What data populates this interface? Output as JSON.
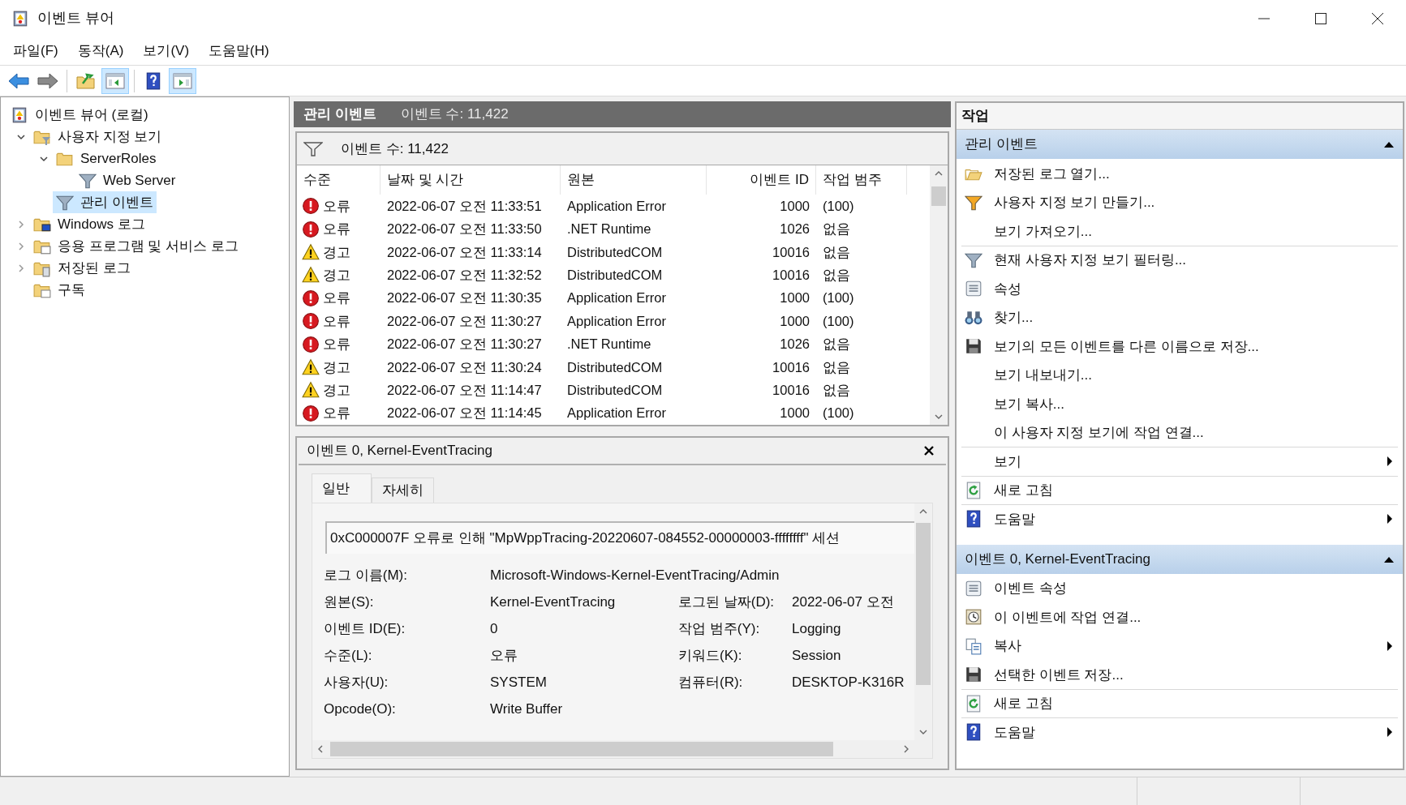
{
  "window": {
    "title": "이벤트 뷰어"
  },
  "menu": [
    "파일(F)",
    "동작(A)",
    "보기(V)",
    "도움말(H)"
  ],
  "toolbar": [
    {
      "kind": "back",
      "pressed": false
    },
    {
      "kind": "forward",
      "pressed": false
    },
    {
      "kind": "up",
      "pressed": false
    },
    {
      "kind": "tree-pane",
      "pressed": true
    },
    {
      "kind": "help",
      "pressed": false
    },
    {
      "kind": "action-pane",
      "pressed": true
    }
  ],
  "tree": [
    {
      "label": "이벤트 뷰어 (로컬)",
      "kind": "viewer",
      "selected": false,
      "children": [
        {
          "label": "사용자 지정 보기",
          "kind": "folder-filter",
          "expanded": true,
          "selected": false,
          "children": [
            {
              "label": "ServerRoles",
              "kind": "folder",
              "expanded": true,
              "selected": false,
              "children": [
                {
                  "label": "Web Server",
                  "kind": "filter",
                  "selected": false
                }
              ]
            },
            {
              "label": "관리 이벤트",
              "kind": "filter",
              "selected": true
            }
          ]
        },
        {
          "label": "Windows 로그",
          "kind": "folder-computer",
          "expanded": false,
          "selected": false
        },
        {
          "label": "응용 프로그램 및 서비스 로그",
          "kind": "folder-window",
          "expanded": false,
          "selected": false
        },
        {
          "label": "저장된 로그",
          "kind": "folder-log",
          "expanded": false,
          "selected": false
        },
        {
          "label": "구독",
          "kind": "folder-calendar",
          "selected": false
        }
      ]
    }
  ],
  "list_panel": {
    "title": "관리 이벤트",
    "count": "이벤트 수: 11,422",
    "filter_count": "이벤트 수: 11,422",
    "columns": [
      "수준",
      "날짜 및 시간",
      "원본",
      "이벤트 ID",
      "작업 범주"
    ],
    "rows": [
      {
        "kind": "error",
        "level": "오류",
        "date": "2022-06-07 오전 11:33:51",
        "source": "Application Error",
        "id": "1000",
        "category": "(100)"
      },
      {
        "kind": "error",
        "level": "오류",
        "date": "2022-06-07 오전 11:33:50",
        "source": ".NET Runtime",
        "id": "1026",
        "category": "없음"
      },
      {
        "kind": "warning",
        "level": "경고",
        "date": "2022-06-07 오전 11:33:14",
        "source": "DistributedCOM",
        "id": "10016",
        "category": "없음"
      },
      {
        "kind": "warning",
        "level": "경고",
        "date": "2022-06-07 오전 11:32:52",
        "source": "DistributedCOM",
        "id": "10016",
        "category": "없음"
      },
      {
        "kind": "error",
        "level": "오류",
        "date": "2022-06-07 오전 11:30:35",
        "source": "Application Error",
        "id": "1000",
        "category": "(100)"
      },
      {
        "kind": "error",
        "level": "오류",
        "date": "2022-06-07 오전 11:30:27",
        "source": "Application Error",
        "id": "1000",
        "category": "(100)"
      },
      {
        "kind": "error",
        "level": "오류",
        "date": "2022-06-07 오전 11:30:27",
        "source": ".NET Runtime",
        "id": "1026",
        "category": "없음"
      },
      {
        "kind": "warning",
        "level": "경고",
        "date": "2022-06-07 오전 11:30:24",
        "source": "DistributedCOM",
        "id": "10016",
        "category": "없음"
      },
      {
        "kind": "warning",
        "level": "경고",
        "date": "2022-06-07 오전 11:14:47",
        "source": "DistributedCOM",
        "id": "10016",
        "category": "없음"
      },
      {
        "kind": "error",
        "level": "오류",
        "date": "2022-06-07 오전 11:14:45",
        "source": "Application Error",
        "id": "1000",
        "category": "(100)"
      }
    ]
  },
  "detail": {
    "title": "이벤트 0, Kernel-EventTracing",
    "tabs": [
      {
        "label": "일반",
        "selected": true
      },
      {
        "label": "자세히",
        "selected": false
      }
    ],
    "message": "0xC000007F 오류로 인해 \"MpWppTracing-20220607-084552-00000003-ffffffff\" 세션",
    "fields": [
      {
        "label": "로그 이름(M):",
        "value": "Microsoft-Windows-Kernel-EventTracing/Admin"
      },
      {
        "label": "원본(S):",
        "value": "Kernel-EventTracing",
        "label_2": "로그된 날짜(D):",
        "value_2": "2022-06-07 오전"
      },
      {
        "label": "이벤트 ID(E):",
        "value": "0",
        "label_2": "작업 범주(Y):",
        "value_2": "Logging"
      },
      {
        "label": "수준(L):",
        "value": "오류",
        "label_2": "키워드(K):",
        "value_2": "Session"
      },
      {
        "label": "사용자(U):",
        "value": "SYSTEM",
        "label_2": "컴퓨터(R):",
        "value_2": "DESKTOP-K316R"
      },
      {
        "label": "Opcode(O):",
        "value": "Write Buffer"
      }
    ]
  },
  "actions": {
    "title": "작업",
    "sections": [
      {
        "title": "관리 이벤트",
        "expanded": true,
        "items": [
          {
            "label": "저장된 로그 열기...",
            "kind": "folder-open",
            "submenu": false,
            "separator_above": false
          },
          {
            "label": "사용자 지정 보기 만들기...",
            "kind": "filter-new",
            "submenu": false,
            "separator_above": false
          },
          {
            "label": "보기 가져오기...",
            "kind": "none",
            "submenu": false,
            "separator_above": false
          },
          {
            "label": "현재 사용자 지정 보기 필터링...",
            "kind": "filter",
            "submenu": false,
            "separator_above": true
          },
          {
            "label": "속성",
            "kind": "properties",
            "submenu": false,
            "separator_above": false
          },
          {
            "label": "찾기...",
            "kind": "find",
            "submenu": false,
            "separator_above": false
          },
          {
            "label": "보기의 모든 이벤트를 다른 이름으로 저장...",
            "kind": "save",
            "submenu": false,
            "separator_above": false
          },
          {
            "label": "보기 내보내기...",
            "kind": "none",
            "submenu": false,
            "separator_above": false
          },
          {
            "label": "보기 복사...",
            "kind": "none",
            "submenu": false,
            "separator_above": false
          },
          {
            "label": "이 사용자 지정 보기에 작업 연결...",
            "kind": "none",
            "submenu": false,
            "separator_above": false
          },
          {
            "label": "보기",
            "kind": "none",
            "submenu": true,
            "separator_above": true
          },
          {
            "label": "새로 고침",
            "kind": "refresh",
            "submenu": false,
            "separator_above": true
          },
          {
            "label": "도움말",
            "kind": "help",
            "submenu": true,
            "separator_above": true
          }
        ]
      },
      {
        "title": "이벤트 0, Kernel-EventTracing",
        "expanded": true,
        "items": [
          {
            "label": "이벤트 속성",
            "kind": "properties",
            "submenu": false,
            "separator_above": false
          },
          {
            "label": "이 이벤트에 작업 연결...",
            "kind": "clock",
            "submenu": false,
            "separator_above": false
          },
          {
            "label": "복사",
            "kind": "copy",
            "submenu": true,
            "separator_above": false
          },
          {
            "label": "선택한 이벤트 저장...",
            "kind": "save",
            "submenu": false,
            "separator_above": false
          },
          {
            "label": "새로 고침",
            "kind": "refresh",
            "submenu": false,
            "separator_above": true
          },
          {
            "label": "도움말",
            "kind": "help",
            "submenu": true,
            "separator_above": true
          }
        ]
      }
    ]
  }
}
